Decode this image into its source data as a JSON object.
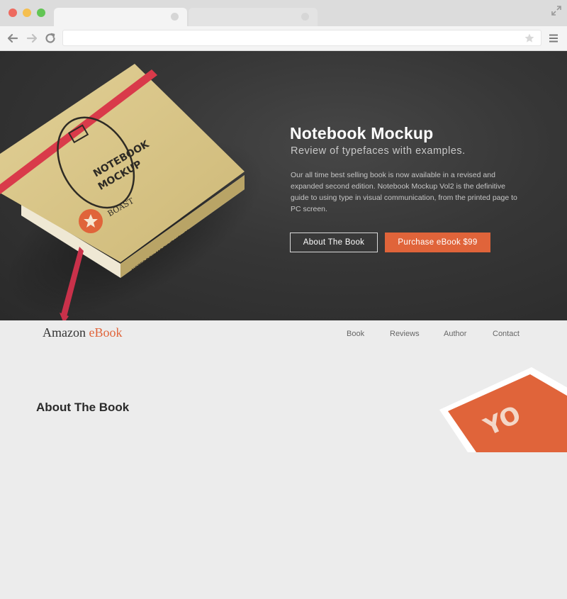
{
  "hero": {
    "title": "Notebook Mockup",
    "subtitle": "Review of typefaces with examples.",
    "description": "Our all time best selling book is now available in a revised and expanded second edition. Notebook Mockup Vol2 is the definitive guide to using type in visual communication, from the printed page to PC screen.",
    "buttons": {
      "about": "About The Book",
      "purchase": "Purchase eBook $99"
    },
    "book_cover": {
      "line1": "NOTEBOOK",
      "line2": "MOCKUP",
      "brand": "BOAST",
      "spine": "NOTEBOOK MOCKUP VOL.02"
    }
  },
  "site": {
    "logo_main": "Amazon ",
    "logo_accent": "eBook",
    "nav": [
      "Book",
      "Reviews",
      "Author",
      "Contact"
    ],
    "section_title": "About The Book"
  },
  "colors": {
    "accent": "#e0643a",
    "book_cover": "#d9c68c",
    "strap": "#d93a4a"
  }
}
